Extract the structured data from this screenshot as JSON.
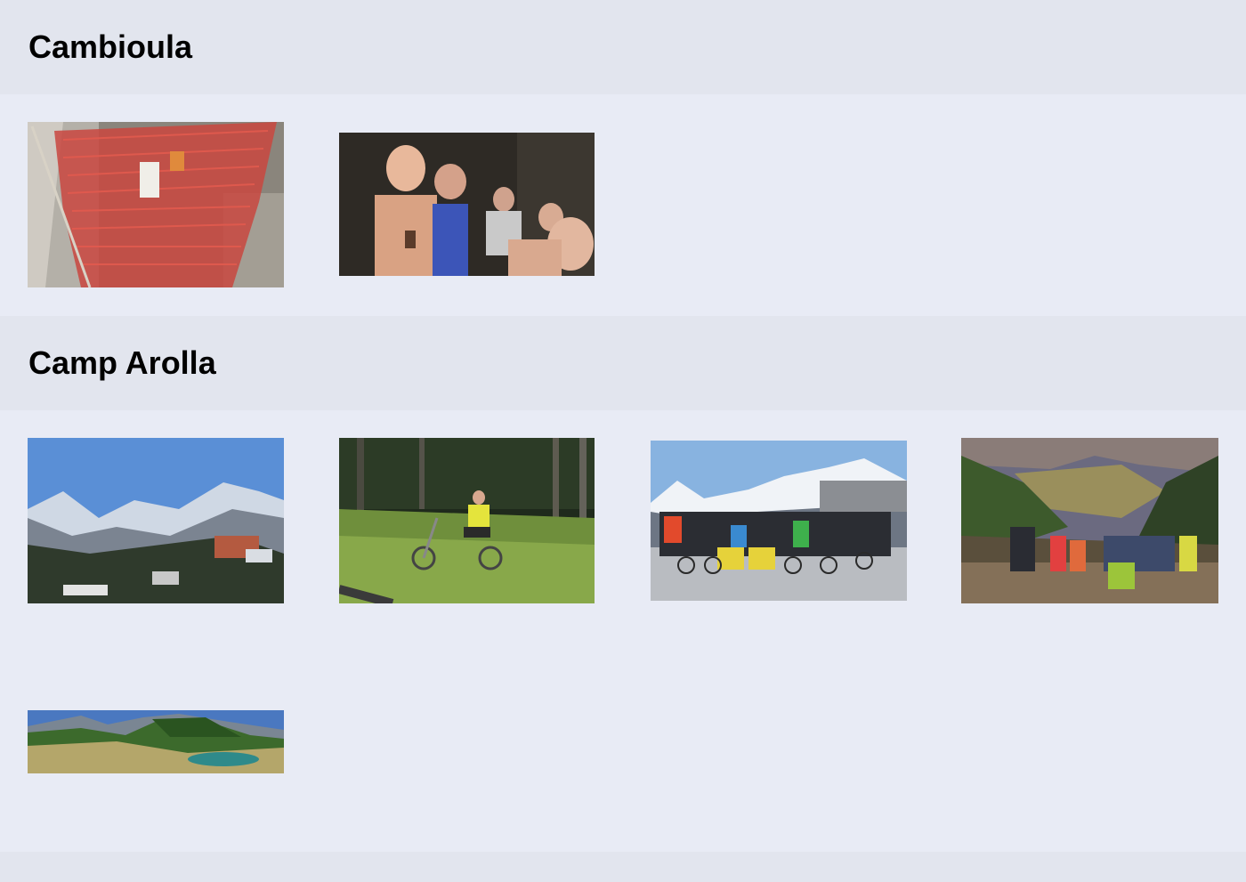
{
  "sections": [
    {
      "title": "Cambioula",
      "photos": [
        {
          "name": "orange-safety-net-photo"
        },
        {
          "name": "group-selfie-cave-photo"
        }
      ]
    },
    {
      "title": "Camp Arolla",
      "photos": [
        {
          "name": "mountain-village-photo"
        },
        {
          "name": "scooter-rider-forest-photo"
        },
        {
          "name": "group-scooters-mountains-photo"
        },
        {
          "name": "group-valley-view-photo"
        },
        {
          "name": "alpine-lake-panorama-photo"
        }
      ]
    }
  ]
}
